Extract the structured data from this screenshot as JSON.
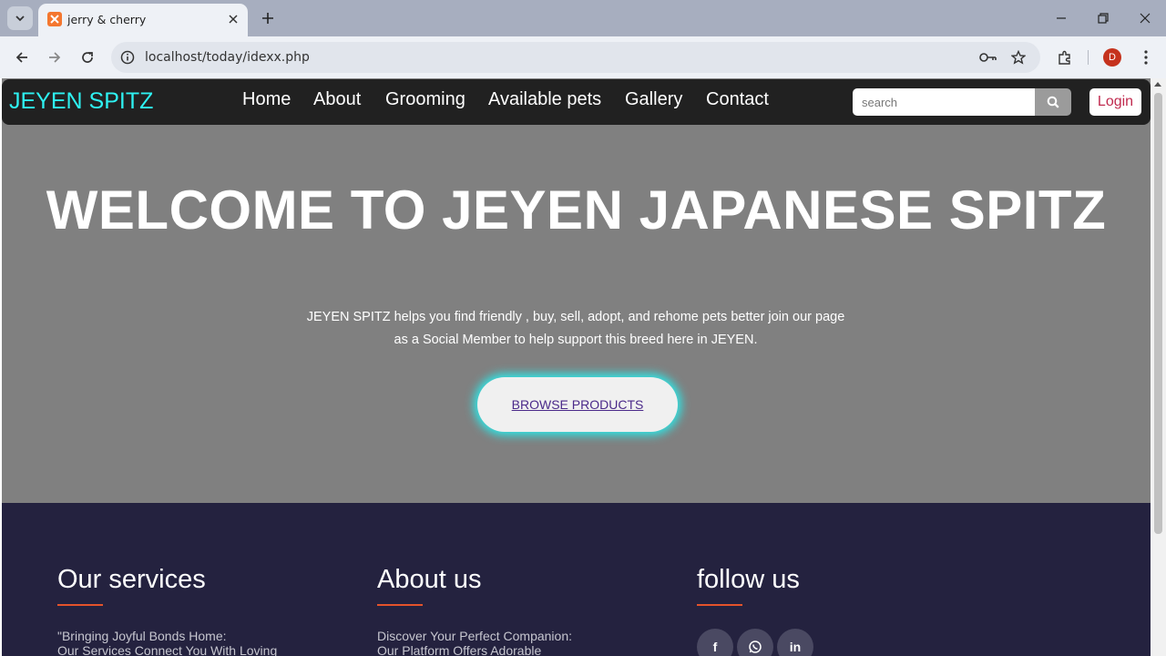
{
  "browser": {
    "tab_title": "jerry & cherry",
    "url": "localhost/today/idexx.php",
    "profile_initial": "D"
  },
  "nav": {
    "brand": "JEYEN SPITZ",
    "links": [
      "Home",
      "About",
      "Grooming",
      "Available pets",
      "Gallery",
      "Contact"
    ],
    "search_placeholder": "search",
    "login": "Login"
  },
  "hero": {
    "title": "WELCOME TO JEYEN JAPANESE SPITZ",
    "text": "JEYEN SPITZ helps you find friendly , buy, sell, adopt, and rehome pets better join our page as a Social Member to help support this breed here in JEYEN.",
    "button": "BROWSE PRODUCTS"
  },
  "footer": {
    "services": {
      "heading": "Our services",
      "text_line1": "\"Bringing Joyful Bonds Home:",
      "text_line2": "Our Services Connect You With Loving"
    },
    "about": {
      "heading": "About us",
      "text_line1": "Discover Your Perfect Companion:",
      "text_line2": "Our Platform Offers Adorable"
    },
    "follow": {
      "heading": "follow us",
      "icons": [
        "facebook-icon",
        "whatsapp-icon",
        "linkedin-icon"
      ],
      "facebook_glyph": "f",
      "linkedin_glyph": "in"
    }
  },
  "colors": {
    "brand": "#2ef1f1",
    "hero_bg": "#808080",
    "nav_bg": "#212121",
    "footer_bg": "#24223f",
    "accent_line": "#e4532b",
    "login_text": "#c02a4e"
  }
}
